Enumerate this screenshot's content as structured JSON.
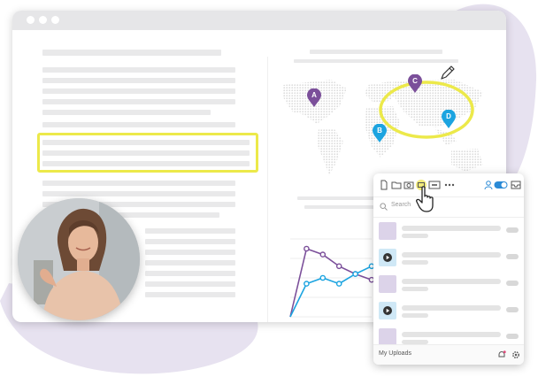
{
  "colors": {
    "purple": "#7b4f9a",
    "blue": "#1ca4e0",
    "highlight": "#ece94a",
    "blob": "#e7e2f0",
    "lavender": "#dcd3e9"
  },
  "browser": {
    "controls": [
      "window-dot",
      "window-dot",
      "window-dot"
    ]
  },
  "map": {
    "pins": [
      {
        "label": "A",
        "color": "#7b4f9a"
      },
      {
        "label": "B",
        "color": "#1ca4e0"
      },
      {
        "label": "C",
        "color": "#7b4f9a"
      },
      {
        "label": "D",
        "color": "#1ca4e0"
      }
    ],
    "annotation_tool": "pencil-icon"
  },
  "chart_data": {
    "type": "line",
    "x": [
      1,
      2,
      3,
      4,
      5,
      6
    ],
    "series": [
      {
        "color": "#7b4f9a",
        "values": [
          0,
          70,
          64,
          52,
          44,
          38
        ]
      },
      {
        "color": "#1ca4e0",
        "values": [
          0,
          34,
          40,
          34,
          44,
          52
        ]
      }
    ],
    "ylim": [
      0,
      80
    ],
    "grid": true
  },
  "uploads_panel": {
    "toolbar_icons": [
      "file-icon",
      "folder-icon",
      "camera-icon",
      "screen-capture-icon",
      "gif-icon",
      "more-icon",
      "user-icon",
      "toggle-switch",
      "inbox-icon"
    ],
    "search_placeholder": "Search",
    "rows": [
      {
        "kind": "image"
      },
      {
        "kind": "video"
      },
      {
        "kind": "image"
      },
      {
        "kind": "video"
      },
      {
        "kind": "image"
      }
    ],
    "footer_label": "My Uploads",
    "footer_icons": [
      "bell-icon",
      "settings-icon"
    ]
  }
}
